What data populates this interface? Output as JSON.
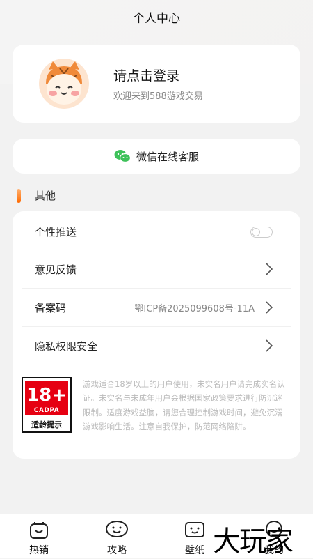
{
  "header": {
    "title": "个人中心"
  },
  "login": {
    "title": "请点击登录",
    "subtitle": "欢迎来到588游戏交易",
    "avatar_icon": "cat-avatar-icon"
  },
  "service": {
    "label": "微信在线客服",
    "icon": "wechat-icon",
    "icon_color": "#3ec15a"
  },
  "section": {
    "title": "其他",
    "accent": "#ff7a1a"
  },
  "menu": {
    "items": [
      {
        "label": "个性推送",
        "control": "toggle",
        "toggle_on": false
      },
      {
        "label": "意见反馈",
        "control": "chevron"
      },
      {
        "label": "备案码",
        "value": "鄂ICP备2025099608号-11A",
        "control": "chevron"
      },
      {
        "label": "隐私权限安全",
        "control": "chevron"
      }
    ]
  },
  "age_badge": {
    "rating": "18+",
    "org": "CADPA",
    "tip": "适龄提示",
    "color": "#e60012"
  },
  "notice": {
    "text": "游戏适合18岁以上的用户使用，未实名用户请完成实名认证。未实名与未成年用户会根据国家政策要求进行防沉迷限制。适度游戏益脑，请您合理控制游戏时间，避免沉溺游戏影响生活。注意自我保护，防范网络陷阱。"
  },
  "tabbar": {
    "tabs": [
      {
        "label": "热销",
        "icon": "hot-sale-icon"
      },
      {
        "label": "攻略",
        "icon": "guide-icon"
      },
      {
        "label": "壁纸",
        "icon": "wallpaper-icon"
      },
      {
        "label": "我的",
        "icon": "profile-icon",
        "active": true
      }
    ]
  },
  "watermark": {
    "text": "大玩家"
  }
}
